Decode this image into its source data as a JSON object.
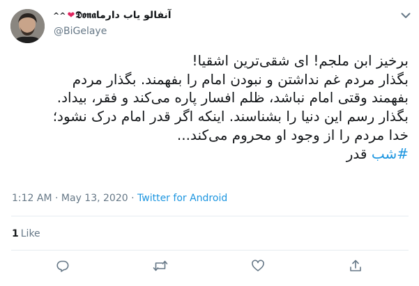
{
  "tweet": {
    "display_name": "آنفالو یاب دارما",
    "name_glyphs": "𝕯𝖔𝖓𝖆",
    "name_hearts": "❤",
    "name_decor": "^^",
    "handle": "@BiGelaye",
    "text_lines": [
      "برخیز ابن ملجم! ای شقی‌ترین اشقیا!",
      "بگذار مردم غم نداشتن و نبودن امام را بفهمند. بگذار مردم",
      "بفهمند وقتی امام نباشد، ظلم افسار پاره می‌کند و فقر، بیداد.",
      "بگذار رسم این دنیا را بشناسند. اینکه اگر قدر امام درک نشود؛",
      "خدا مردم را از وجود او محروم می‌کند..."
    ],
    "hashtag": "#شب",
    "hashtag_tail": " قدر",
    "time": "1:12 AM",
    "separator": "·",
    "date": "May 13, 2020",
    "source": "Twitter for Android",
    "like_count": "1",
    "like_label": "Like"
  },
  "icons": [
    "chevron-down-icon",
    "reply-icon",
    "retweet-icon",
    "like-icon",
    "share-icon"
  ],
  "colors": {
    "accent": "#1b95e0",
    "muted": "#657786",
    "heart": "#e0245e",
    "divider": "#e6ecf0"
  }
}
